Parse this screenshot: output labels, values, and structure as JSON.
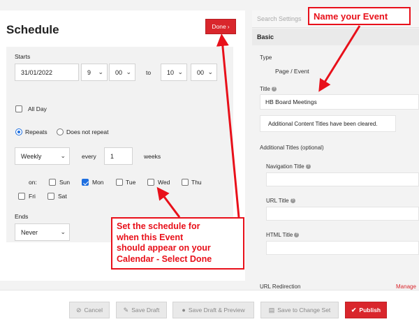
{
  "schedule": {
    "title": "Schedule",
    "done_label": "Done",
    "starts_label": "Starts",
    "start_date": "31/01/2022",
    "start_hour": "9",
    "start_minute": "00",
    "to_label": "to",
    "end_hour": "10",
    "end_minute": "00",
    "all_day_label": "All Day",
    "repeats_label": "Repeats",
    "does_not_repeat_label": "Does not repeat",
    "frequency": "Weekly",
    "every_label": "every",
    "interval": "1",
    "interval_unit": "weeks",
    "on_label": "on:",
    "days": [
      {
        "label": "Sun",
        "checked": false
      },
      {
        "label": "Mon",
        "checked": true
      },
      {
        "label": "Tue",
        "checked": false
      },
      {
        "label": "Wed",
        "checked": false
      },
      {
        "label": "Thu",
        "checked": false
      },
      {
        "label": "Fri",
        "checked": false
      },
      {
        "label": "Sat",
        "checked": false
      }
    ],
    "ends_label": "Ends",
    "ends_value": "Never"
  },
  "settings": {
    "search_placeholder": "Search Settings",
    "section_title": "Basic",
    "type_label": "Type",
    "type_value": "Page / Event",
    "title_label": "Title",
    "title_value": "HB Board Meetings",
    "notice": "Additional Content Titles have been cleared.",
    "additional_titles_label": "Additional Titles (optional)",
    "nav_title_label": "Navigation Title",
    "url_title_label": "URL Title",
    "html_title_label": "HTML Title",
    "url_redirection_label": "URL Redirection",
    "manage_label": "Manage"
  },
  "actions": {
    "cancel": "Cancel",
    "save_draft": "Save Draft",
    "save_draft_preview": "Save Draft & Preview",
    "save_to_change_set": "Save to Change Set",
    "publish": "Publish"
  },
  "annotations": {
    "top": "Name your Event",
    "middle_line1": "Set the schedule for",
    "middle_line2": "when this Event",
    "middle_line3": "should appear on your",
    "middle_line4": "Calendar - Select Done"
  },
  "colors": {
    "accent": "#d9262c",
    "annotation": "#e8101a",
    "checkbox": "#1e6fe0"
  }
}
